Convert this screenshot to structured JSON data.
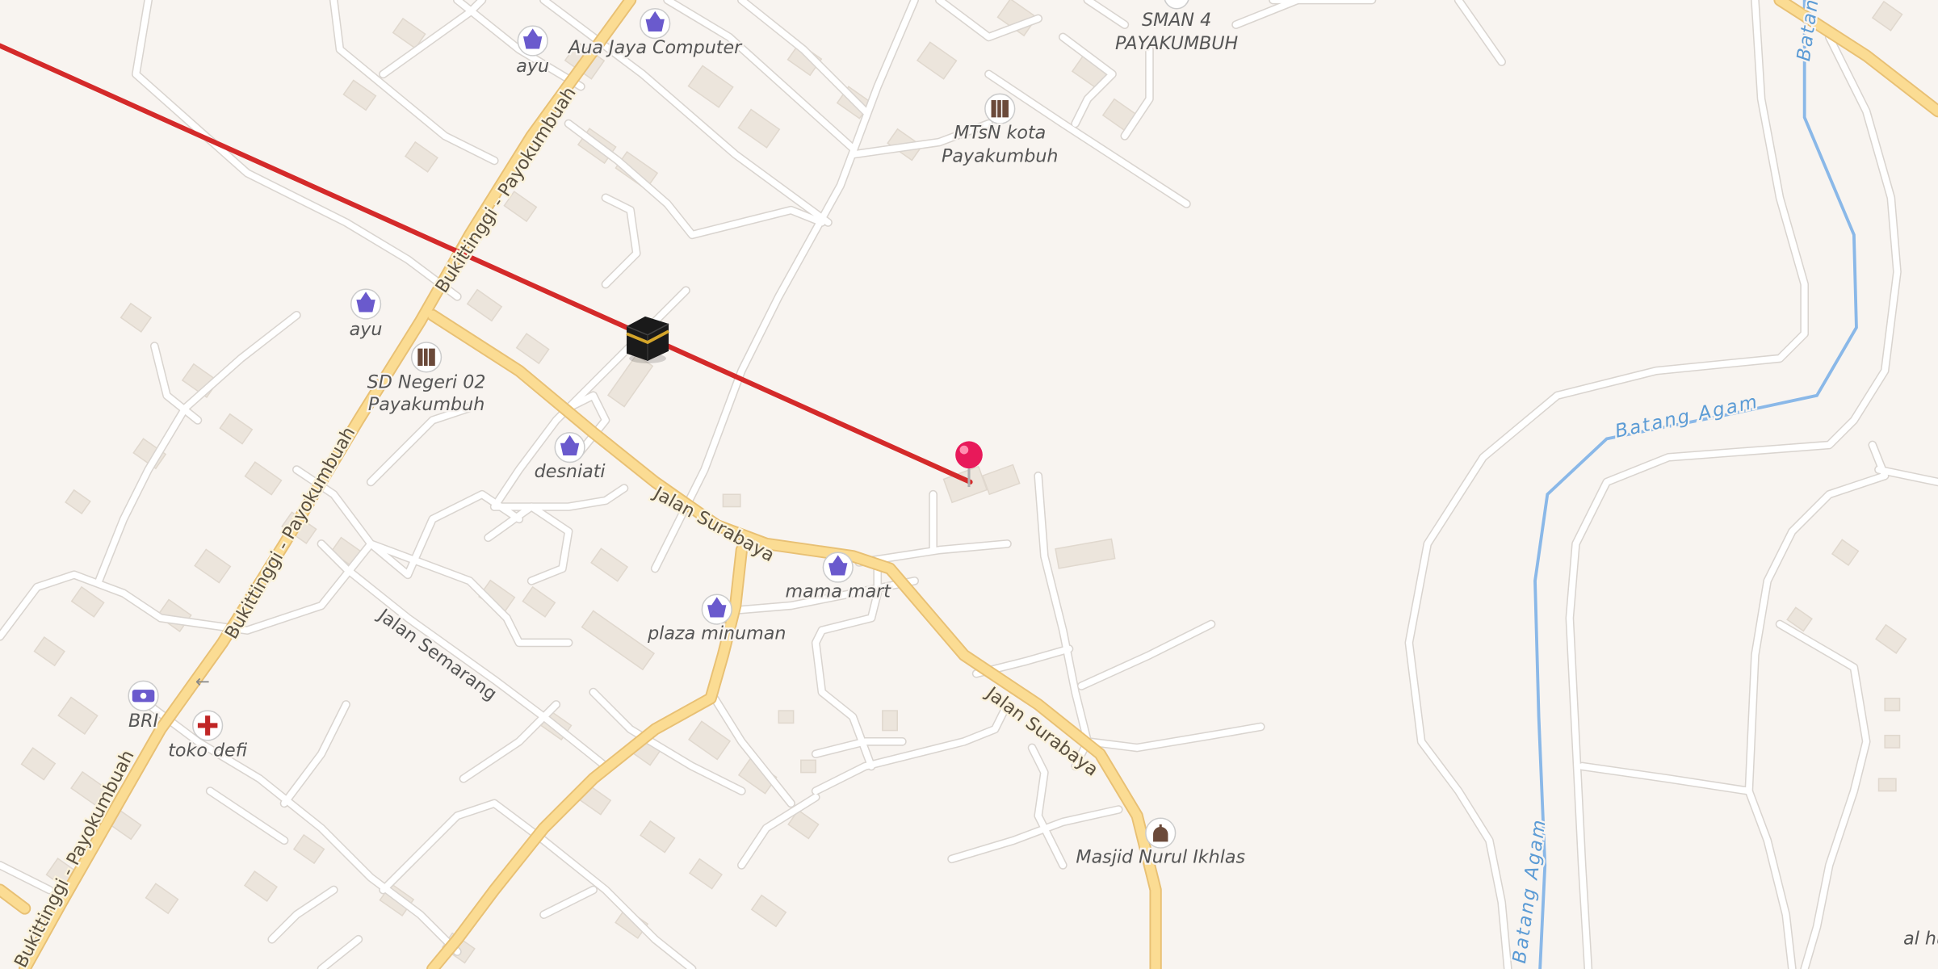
{
  "colors": {
    "background": "#f8f4f0",
    "minor_road": "#ffffff",
    "road_casing": "#d9d4cf",
    "primary_road": "#fbdc93",
    "primary_casing": "#e8c074",
    "building": "#ece5dc",
    "water": "#8ab8e8",
    "qibla_line": "#d42a2a",
    "pin": "#e8195a"
  },
  "roads": {
    "primary_1": "Bukittinggi - Payokumbuah",
    "primary_2": "Bukittinggi - Payokumbuah",
    "primary_3": "Bukittinggi - Payokumbuah",
    "surabaya_1": "Jalan Surabaya",
    "surabaya_2": "Jalan Surabaya",
    "semarang": "Jalan Semarang"
  },
  "water": {
    "river_1": "Batang Agam",
    "river_2": "Batang Agam",
    "river_3": "Batang"
  },
  "pois": [
    {
      "name": "Aua Jaya Computer",
      "icon": "shop-basket-icon"
    },
    {
      "name": "ayu",
      "icon": "shop-basket-icon"
    },
    {
      "name": "ayu",
      "icon": "shop-basket-icon"
    },
    {
      "name": "SD Negeri 02",
      "name2": "Payakumbuh",
      "icon": "school-icon"
    },
    {
      "name": "desniati",
      "icon": "shop-basket-icon"
    },
    {
      "name": "mama mart",
      "icon": "shop-basket-icon"
    },
    {
      "name": "plaza minuman",
      "icon": "shop-basket-icon"
    },
    {
      "name": "MTsN kota",
      "name2": "Payakumbuh",
      "icon": "school-icon"
    },
    {
      "name": "SMAN 4",
      "name2": "PAYAKUMBUH",
      "icon": "school-icon"
    },
    {
      "name": "BRI",
      "icon": "bank-icon"
    },
    {
      "name": "toko defi",
      "icon": "pharmacy-icon"
    },
    {
      "name": "Masjid Nurul Ikhlas",
      "icon": "mosque-icon"
    },
    {
      "name": "al hu",
      "icon": "none"
    }
  ],
  "markers": {
    "kaaba": "kaaba-icon",
    "location": "location-pin-icon"
  }
}
